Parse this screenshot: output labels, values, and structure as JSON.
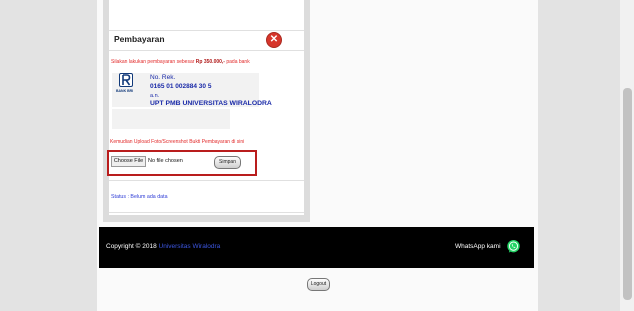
{
  "payment": {
    "title": "Pembayaran",
    "instruction_prefix": "Silakan lakukan pembayaran sebesar ",
    "amount": "Rp 350.000,-",
    "instruction_suffix": " pada bank",
    "bank": {
      "logo_text": "BANK BRI",
      "account_label": "No. Rek.",
      "account_number": "0165 01 002884 30 5",
      "an_label": "a.n.",
      "account_name": "UPT PMB UNIVERSITAS WIRALODRA"
    },
    "upload_instruction": "Kemudian Upload Foto/Screenshot Bukti Pembayaran di sini",
    "choose_file_label": "Choose File",
    "no_file_text": "No file chosen",
    "save_label": "Simpan",
    "status": "Status : Belum ada data"
  },
  "footer": {
    "copyright_prefix": "Copyright © 2018 ",
    "copyright_link": "Universitas Wiralodra",
    "whatsapp_label": "WhatsApp kami"
  },
  "logout_label": "Logout",
  "colors": {
    "accent_red": "#e22a2a",
    "link_blue": "#2e3cd6",
    "footer_bg": "#000000",
    "whatsapp_green": "#25d366"
  }
}
